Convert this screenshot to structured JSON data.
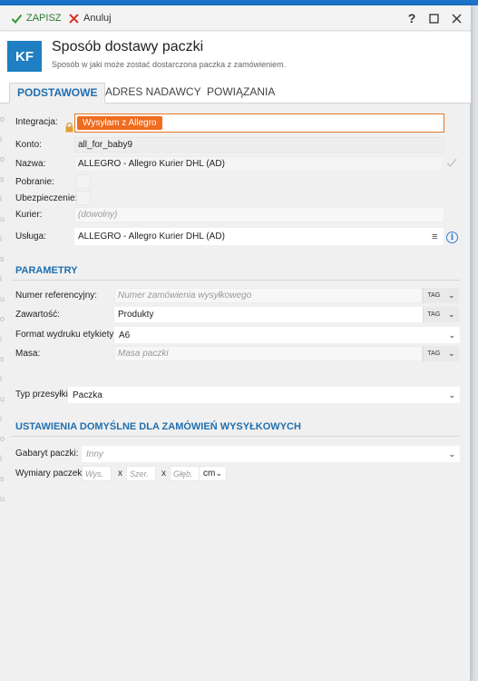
{
  "toolbar": {
    "save_label": "ZAPISZ",
    "cancel_label": "Anuluj",
    "help_glyph": "?"
  },
  "header": {
    "badge": "KF",
    "title": "Sposób dostawy paczki",
    "subtitle": "Sposób w jaki może zostać dostarczona paczka z zamówieniem."
  },
  "tabs": [
    {
      "label": "PODSTAWOWE",
      "active": true
    },
    {
      "label": "ADRES NADAWCY",
      "active": false
    },
    {
      "label": "POWIĄZANIA",
      "active": false
    }
  ],
  "basic": {
    "integration_label": "Integracja:",
    "integration_value": "Wysyłam z Allegro",
    "account_label": "Konto:",
    "account_value": "all_for_baby9",
    "name_label": "Nazwa:",
    "name_value": "ALLEGRO - Allegro Kurier DHL (AD)",
    "cod_label": "Pobranie:",
    "insurance_label": "Ubezpieczenie:",
    "courier_label": "Kurier:",
    "courier_placeholder": "(dowolny)",
    "service_label": "Usługa:",
    "service_value": "ALLEGRO - Allegro Kurier DHL (AD)",
    "service_menu_glyph": "≡",
    "info_glyph": "i"
  },
  "parameters": {
    "title": "PARAMETRY",
    "ref_label": "Numer referencyjny:",
    "ref_placeholder": "Numer zamówienia wysyłkowego",
    "content_label": "Zawartość:",
    "content_value": "Produkty",
    "format_label": "Format wydruku etykiety:",
    "format_value": "A6",
    "weight_label": "Masa:",
    "weight_placeholder": "Masa paczki",
    "tag_label": "TAG",
    "shipment_type_label": "Typ przesyłki:",
    "shipment_type_value": "Paczka"
  },
  "defaults": {
    "title": "USTAWIENIA DOMYŚLNE DLA ZAMÓWIEŃ WYSYŁKOWYCH",
    "size_label": "Gabaryt paczki:",
    "size_value": "Inny",
    "dims_label": "Wymiary paczek:",
    "height_placeholder": "Wys.",
    "width_placeholder": "Szer.",
    "depth_placeholder": "Głęb.",
    "x_sign": "x",
    "unit": "cm"
  },
  "colors": {
    "accent": "#1f6fb0",
    "badge": "#1f7fc2",
    "chip": "#f06c1f",
    "save_check": "#2a9a2a",
    "cancel_x": "#d9342b"
  }
}
